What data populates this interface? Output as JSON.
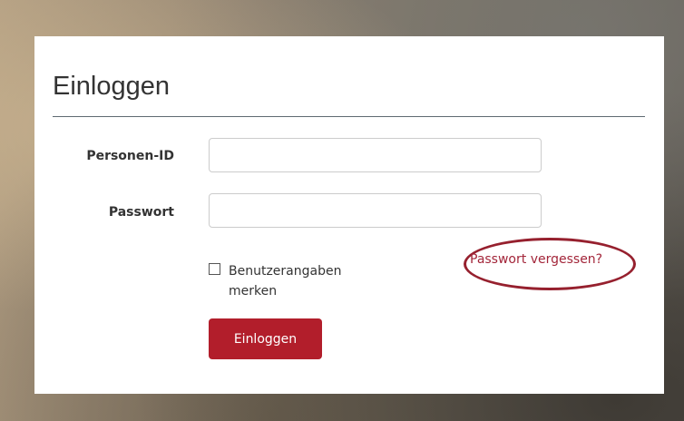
{
  "login": {
    "title": "Einloggen",
    "person_id_label": "Personen-ID",
    "person_id_value": "",
    "password_label": "Passwort",
    "password_value": "",
    "remember_label": "Benutzerangaben merken",
    "remember_checked": false,
    "forgot_link": "Passwort vergessen?",
    "submit_label": "Einloggen"
  },
  "colors": {
    "accent": "#b21e2b",
    "link": "#a3263a",
    "highlight_ellipse": "#96202e"
  }
}
